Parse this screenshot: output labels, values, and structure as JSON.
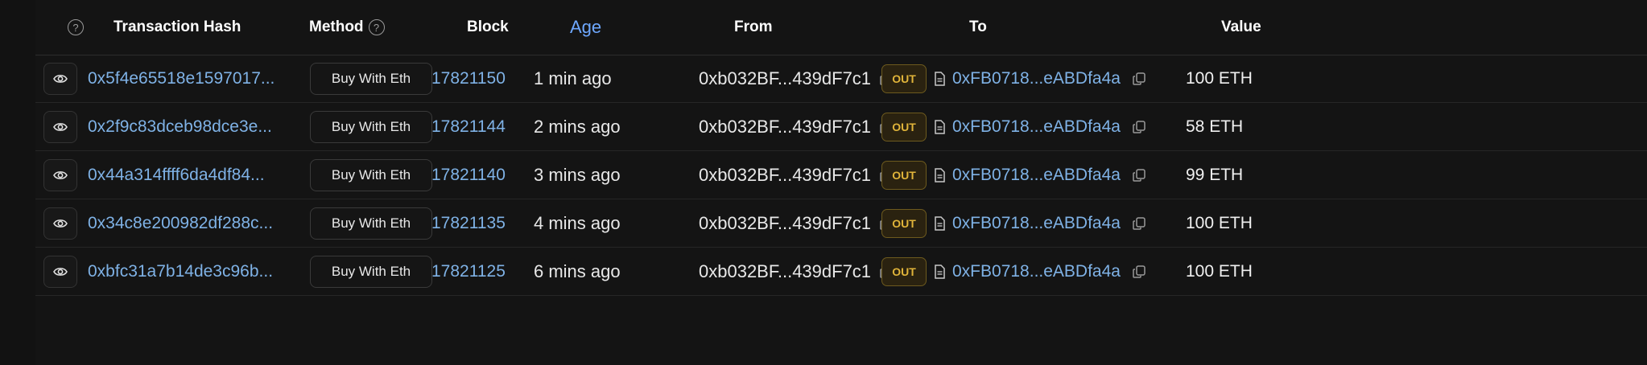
{
  "columns": {
    "transaction_hash": "Transaction Hash",
    "method": "Method",
    "block": "Block",
    "age": "Age",
    "from": "From",
    "to": "To",
    "value": "Value"
  },
  "icons": {
    "help": "question-circle-icon",
    "eye": "eye-icon",
    "copy": "copy-icon",
    "contract": "document-icon"
  },
  "colors": {
    "link": "#7fb2e6",
    "age_header": "#6ea8ff",
    "out_badge": "#e0b43a"
  },
  "rows": [
    {
      "hash": "0x5f4e65518e1597017...",
      "method": "Buy With Eth",
      "block": "17821150",
      "age": "1 min ago",
      "from": "0xb032BF...439dF7c1",
      "direction": "OUT",
      "to": "0xFB0718...eABDfa4a",
      "value": "100 ETH"
    },
    {
      "hash": "0x2f9c83dceb98dce3e...",
      "method": "Buy With Eth",
      "block": "17821144",
      "age": "2 mins ago",
      "from": "0xb032BF...439dF7c1",
      "direction": "OUT",
      "to": "0xFB0718...eABDfa4a",
      "value": "58 ETH"
    },
    {
      "hash": "0x44a314ffff6da4df84...",
      "method": "Buy With Eth",
      "block": "17821140",
      "age": "3 mins ago",
      "from": "0xb032BF...439dF7c1",
      "direction": "OUT",
      "to": "0xFB0718...eABDfa4a",
      "value": "99 ETH"
    },
    {
      "hash": "0x34c8e200982df288c...",
      "method": "Buy With Eth",
      "block": "17821135",
      "age": "4 mins ago",
      "from": "0xb032BF...439dF7c1",
      "direction": "OUT",
      "to": "0xFB0718...eABDfa4a",
      "value": "100 ETH"
    },
    {
      "hash": "0xbfc31a7b14de3c96b...",
      "method": "Buy With Eth",
      "block": "17821125",
      "age": "6 mins ago",
      "from": "0xb032BF...439dF7c1",
      "direction": "OUT",
      "to": "0xFB0718...eABDfa4a",
      "value": "100 ETH"
    }
  ]
}
